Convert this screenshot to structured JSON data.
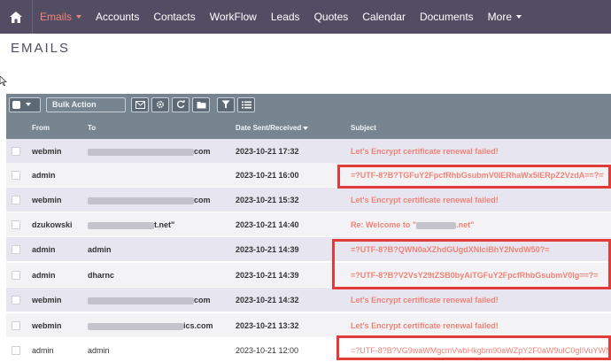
{
  "nav": {
    "items": [
      {
        "label": "Emails",
        "active": true,
        "has_caret": true
      },
      {
        "label": "Accounts"
      },
      {
        "label": "Contacts"
      },
      {
        "label": "WorkFlow"
      },
      {
        "label": "Leads"
      },
      {
        "label": "Quotes"
      },
      {
        "label": "Calendar"
      },
      {
        "label": "Documents"
      },
      {
        "label": "More",
        "has_caret": true
      }
    ],
    "home_icon": "home-icon"
  },
  "page": {
    "title": "EMAILS"
  },
  "toolbar": {
    "bulk_action": "Bulk Action",
    "buttons": [
      "compose-icon",
      "gear-icon",
      "refresh-icon",
      "folder-icon",
      "filter-icon",
      "list-icon"
    ]
  },
  "table": {
    "headers": {
      "from": "From",
      "to": "To",
      "date": "Date Sent/Received",
      "subject": "Subject"
    },
    "rows": [
      {
        "from": "webmin",
        "to_suffix": "com",
        "date": "2023-10-21 17:32",
        "subject": "Let's Encrypt certificate renewal failed!"
      },
      {
        "from": "admin",
        "to_suffix": "",
        "date": "2023-10-21 16:00",
        "subject": "=?UTF-8?B?TGFuY2FpcfRhbGsubmV0IERhaWx5IERpZ2VzdA==?="
      },
      {
        "from": "webmin",
        "to_suffix": "com",
        "date": "2023-10-21 15:32",
        "subject": "Let's Encrypt certificate renewal failed!"
      },
      {
        "from": "dzukowski",
        "to_suffix": "t.net\"",
        "date": "2023-10-21 14:40",
        "subject_prefix": "Re: Welcome to \"",
        "subject_suffix": ".net\""
      },
      {
        "from": "admin",
        "to": "admin",
        "date": "2023-10-21 14:39",
        "subject": "=?UTF-8?B?QWN0aXZhdGUgdXNlciBhY2NvdW50?="
      },
      {
        "from": "admin",
        "to": "dharnc",
        "date": "2023-10-21 14:39",
        "subject": "=?UTF-8?B?V2VsY29tZSB0byAiTGFuY2FpcfRhbGsubmV0Ig==?="
      },
      {
        "from": "webmin",
        "to_suffix": "com",
        "date": "2023-10-21 14:32",
        "subject": "Let's Encrypt certificate renewal failed!"
      },
      {
        "from": "webmin",
        "to_suffix": "ics.com",
        "date": "2023-10-21 13:32",
        "subject": "Let's Encrypt certificate renewal failed!"
      },
      {
        "from": "admin",
        "to": "admin",
        "date": "2023-10-21 12:00",
        "subject": "=?UTF-8?B?VG9waWMgcmVwbHkgbm90aWZpY2F0aW9uIC0gIlVuYWN"
      }
    ]
  },
  "colors": {
    "nav_bg": "#534d64",
    "accent": "#f08377",
    "toolbar_bg": "#778591",
    "highlight": "#e23b3b"
  }
}
